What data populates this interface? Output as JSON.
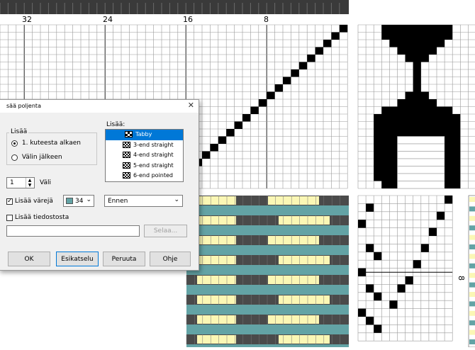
{
  "ruler": {
    "labels": [
      "32",
      "24",
      "16",
      "8"
    ],
    "right_labels": [
      "8"
    ]
  },
  "colors": {
    "teal": "#63a3a5",
    "yellow": "#fbf7b5",
    "dark": "#4a4a4a",
    "select": "#0078d7"
  },
  "dialog": {
    "title": "sää poljenta",
    "close_icon": "close-icon",
    "lisaa_group_label": "Lisää",
    "radio_first": "1. kuteesta alkaen",
    "radio_after": "Välin jälkeen",
    "spin_value": "1",
    "spin_label": "Väli",
    "color_checkbox_label": "Lisää värejä",
    "color_value": "34",
    "position_value": "Ennen",
    "file_checkbox_label": "Lisää tiedostosta",
    "file_path_value": "",
    "browse_label": "Selaa...",
    "list_label": "Lisää:",
    "list_items": [
      "Tabby",
      "3-end straight",
      "4-end straight",
      "5-end straight",
      "6-end pointed"
    ],
    "ok_label": "OK",
    "preview_label": "Esikatselu",
    "cancel_label": "Peruuta",
    "help_label": "Ohje"
  }
}
